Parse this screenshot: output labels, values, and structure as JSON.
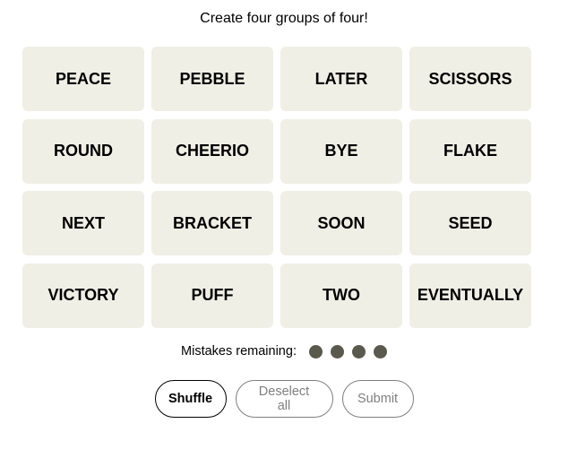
{
  "header": {
    "subtitle": "Create four groups of four!"
  },
  "grid": {
    "tiles": [
      "PEACE",
      "PEBBLE",
      "LATER",
      "SCISSORS",
      "ROUND",
      "CHEERIO",
      "BYE",
      "FLAKE",
      "NEXT",
      "BRACKET",
      "SOON",
      "SEED",
      "VICTORY",
      "PUFF",
      "TWO",
      "EVENTUALLY"
    ]
  },
  "mistakes": {
    "label": "Mistakes remaining:",
    "remaining": 4,
    "total": 4
  },
  "buttons": {
    "shuffle": "Shuffle",
    "deselect_all": "Deselect all",
    "submit": "Submit"
  },
  "colors": {
    "tile_bg": "#efefe6",
    "dot": "#5a594e",
    "disabled": "#7f7f7f"
  }
}
